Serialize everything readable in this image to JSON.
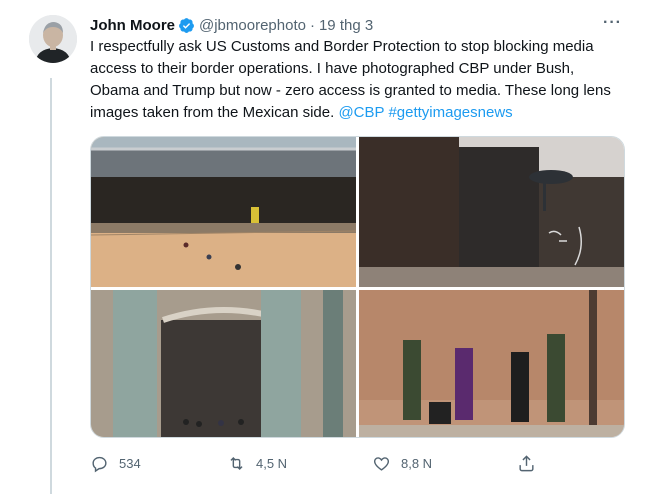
{
  "tweet": {
    "author_name": "John Moore",
    "handle": "@jbmoorephoto",
    "separator": "·",
    "time": "19 thg 3",
    "more": "···",
    "text_plain": "I respectfully ask US Customs and Border Protection to stop blocking media access to their border operations. I have photographed CBP under Bush, Obama and Trump but now - zero access is granted to media. These long lens images taken from the Mexican side.",
    "mention": "@CBP",
    "hashtag": "#gettyimagesnews"
  },
  "actions": {
    "replies": "534",
    "retweets": "4,5 N",
    "likes": "8,8 N"
  },
  "icons": {
    "verified": "verified-badge-icon",
    "more": "more-icon",
    "reply": "reply-icon",
    "retweet": "retweet-icon",
    "like": "heart-icon",
    "share": "share-icon"
  },
  "colors": {
    "accent": "#1d9bf0",
    "secondary_text": "#536471",
    "primary_text": "#0f1419"
  }
}
